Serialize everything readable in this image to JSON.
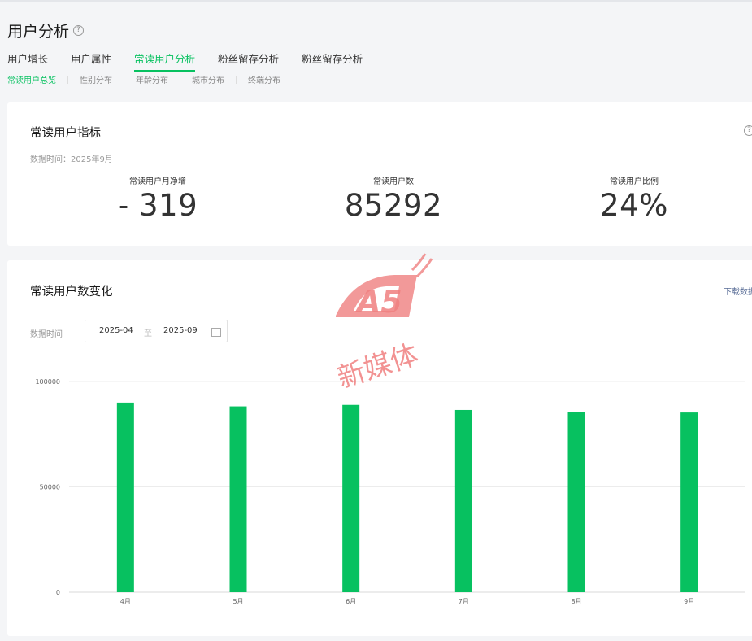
{
  "page": {
    "title": "用户分析",
    "help_glyph": "?"
  },
  "tabs": [
    {
      "label": "用户增长",
      "active": false
    },
    {
      "label": "用户属性",
      "active": false
    },
    {
      "label": "常读用户分析",
      "active": true
    },
    {
      "label": "粉丝留存分析",
      "active": false
    },
    {
      "label": "粉丝留存分析",
      "active": false
    }
  ],
  "subtabs": [
    {
      "label": "常读用户总览",
      "active": true
    },
    {
      "label": "性别分布",
      "active": false
    },
    {
      "label": "年龄分布",
      "active": false
    },
    {
      "label": "城市分布",
      "active": false
    },
    {
      "label": "终端分布",
      "active": false
    }
  ],
  "metrics_card": {
    "title": "常读用户指标",
    "data_time": "数据时间：2025年9月",
    "metrics": [
      {
        "label": "常读用户月净增",
        "value": "- 319"
      },
      {
        "label": "常读用户数",
        "value": "85292"
      },
      {
        "label": "常读用户比例",
        "value": "24%"
      }
    ]
  },
  "trend_card": {
    "title": "常读用户数变化",
    "download_label": "下载数据",
    "range_label": "数据时间",
    "range_start": "2025-04",
    "range_to": "至",
    "range_end": "2025-09"
  },
  "watermark": {
    "logo_text": "A5",
    "text": "新媒体"
  },
  "colors": {
    "accent": "#07c160",
    "bar": "#07c160",
    "link": "#576b95",
    "watermark": "#f08080"
  },
  "chart_data": {
    "type": "bar",
    "categories": [
      "4月",
      "5月",
      "6月",
      "7月",
      "8月",
      "9月"
    ],
    "values": [
      90000,
      88200,
      88900,
      86500,
      85500,
      85292
    ],
    "ylim": [
      0,
      100000
    ],
    "yticks": [
      0,
      50000,
      100000
    ],
    "ytick_labels": [
      "0",
      "50000",
      "100000"
    ],
    "grid": true,
    "title": "",
    "xlabel": "",
    "ylabel": ""
  }
}
